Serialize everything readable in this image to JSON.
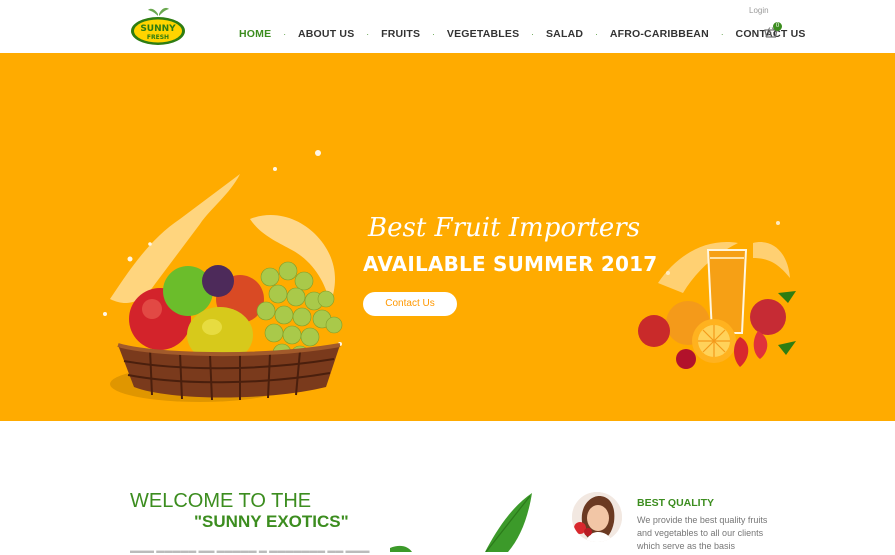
{
  "brand": {
    "logo_line1": "SUNNY",
    "logo_line2": "FRESH"
  },
  "header": {
    "login": "Login",
    "nav": [
      "HOME",
      "ABOUT US",
      "FRUITS",
      "VEGETABLES",
      "SALAD",
      "AFRO-CARIBBEAN",
      "CONTACT US"
    ],
    "active_nav": "HOME",
    "cart_count": "0"
  },
  "hero": {
    "script_title": "Best Fruit Importers",
    "main_title": "AVAILABLE SUMMER 2017",
    "button": "Contact Us",
    "slides": 2,
    "active_slide": 1,
    "background_color": "#ffab00"
  },
  "intro": {
    "title_line1": "WELCOME TO THE",
    "title_line2": "\"SUNNY EXOTICS\""
  },
  "feature": {
    "title": "BEST QUALITY",
    "text": "We provide the best quality fruits and vegetables to all our clients which serve as the basis"
  },
  "colors": {
    "accent": "#3c8d1f",
    "hero": "#ffab00",
    "text": "#333333"
  }
}
